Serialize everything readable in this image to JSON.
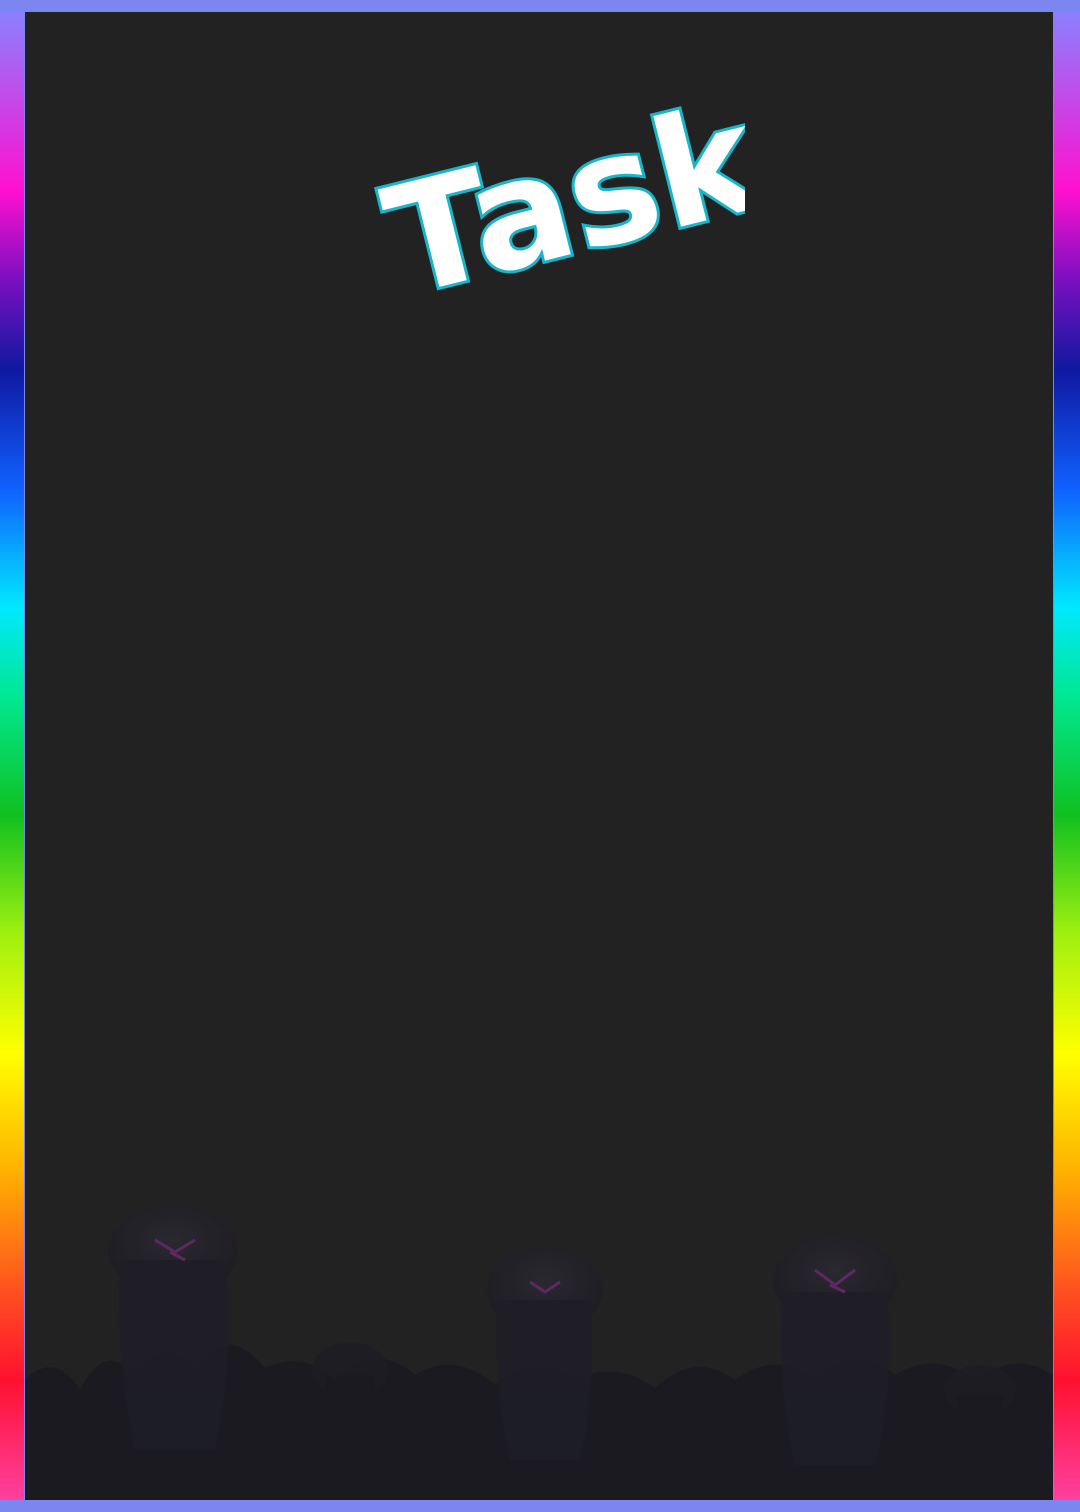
{
  "title": "Task",
  "colors": {
    "frame": "#7b86f0",
    "board": "#222222",
    "title_fill": "#ffffff",
    "title_outline": "#19b5c8"
  },
  "decorations": {
    "border": "rainbow-vertical-strips",
    "scenery": "dark-silhouette-figures"
  }
}
